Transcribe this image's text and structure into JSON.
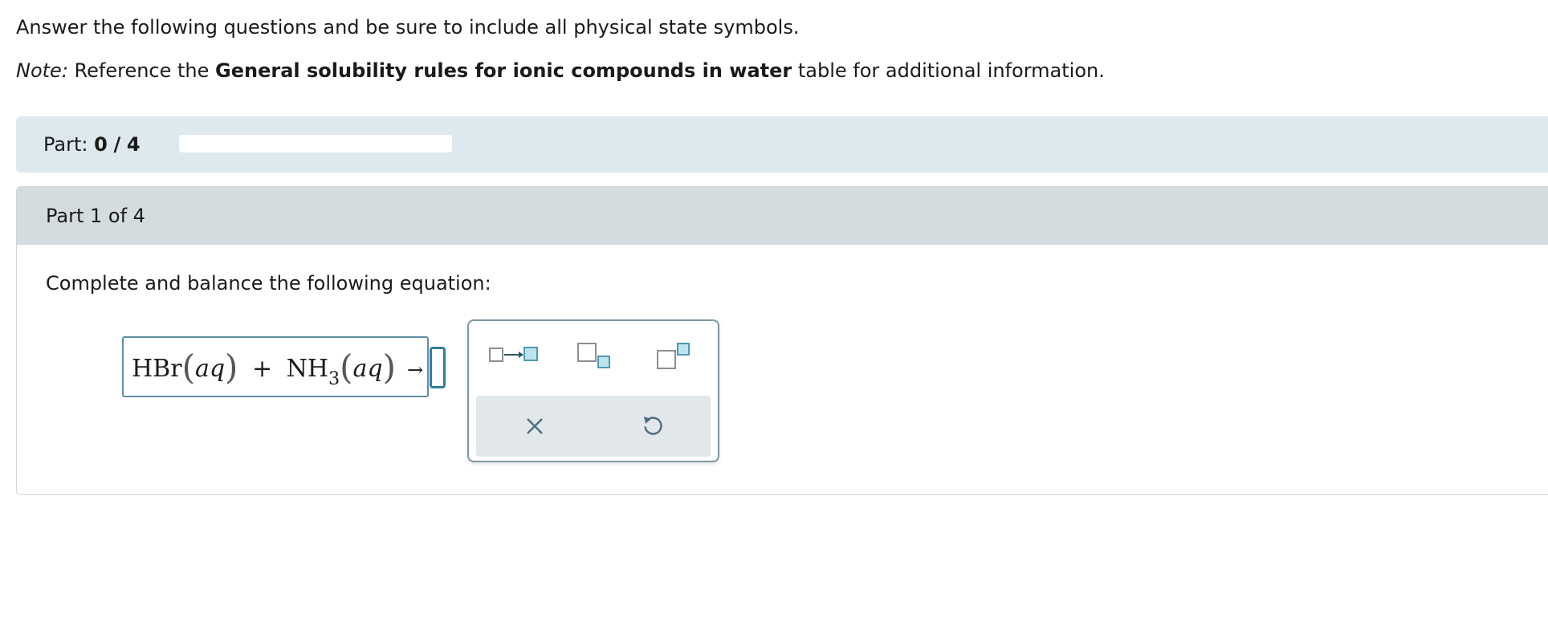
{
  "intro": {
    "text": "Answer the following questions and be sure to include all physical state symbols."
  },
  "note": {
    "label": "Note:",
    "prefix": " Reference the ",
    "bold": "General solubility rules for ionic compounds in water",
    "suffix": " table for additional information."
  },
  "progress": {
    "label": "Part:",
    "current": "0",
    "separator": "/",
    "total": "4",
    "fill_fraction": 0,
    "fill_color": "#4d89b0"
  },
  "part": {
    "title": "Part 1 of 4",
    "question": "Complete and balance the following equation:"
  },
  "equation": {
    "reactant1": "HBr",
    "state1": "aq",
    "plus": "+",
    "reactant2": "NH",
    "reactant2_sub": "3",
    "state2": "aq",
    "arrow": "→"
  },
  "palette": {
    "tools": [
      {
        "icon": "reaction-arrow-template-icon"
      },
      {
        "icon": "subscript-template-icon"
      },
      {
        "icon": "superscript-template-icon"
      }
    ],
    "actions": [
      {
        "icon": "clear-x-icon"
      },
      {
        "icon": "undo-icon"
      }
    ],
    "accent_color": "#4a9bb5",
    "fill_color": "#bfe3ee"
  }
}
